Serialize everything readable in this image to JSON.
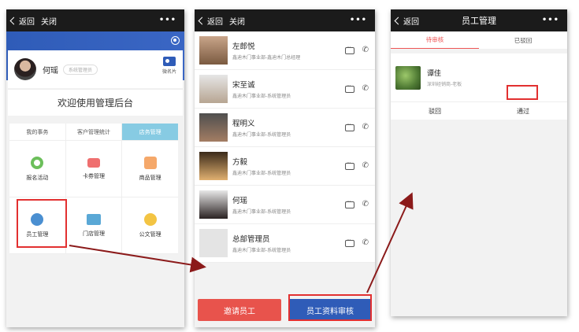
{
  "phone1": {
    "nav": {
      "back": "返回",
      "close": "关闭",
      "more": "•••"
    },
    "user": {
      "name": "何瑶",
      "role": "系统管理员"
    },
    "business_card": "微名片",
    "welcome": "欢迎使用管理后台",
    "tabs": [
      "我的事务",
      "客户管理统计",
      "店务管理"
    ],
    "menu": [
      "报名活动",
      "卡券管理",
      "商品管理",
      "员工管理",
      "门店管理",
      "公文管理"
    ]
  },
  "phone2": {
    "nav": {
      "back": "返回",
      "close": "关闭",
      "more": "•••"
    },
    "contacts": [
      {
        "name": "左郎悦",
        "sub": "鑫迪木门事业部-鑫迪木门总经理"
      },
      {
        "name": "宋至诚",
        "sub": "鑫迪木门事业部-系统管理员"
      },
      {
        "name": "程明义",
        "sub": "鑫迪木门事业部-系统管理员"
      },
      {
        "name": "方毅",
        "sub": "鑫迪木门事业部-系统管理员"
      },
      {
        "name": "何瑶",
        "sub": "鑫迪木门事业部-系统管理员"
      },
      {
        "name": "总部管理员",
        "sub": "鑫迪木门事业部-系统管理员"
      }
    ],
    "invite_label": "邀请员工",
    "review_label": "员工资料审核"
  },
  "phone3": {
    "nav": {
      "back": "返回",
      "title": "员工管理",
      "more": "•••"
    },
    "tabs": [
      "待审核",
      "已驳回"
    ],
    "request": {
      "name": "谭佳",
      "sub": "深圳经销商-老板"
    },
    "reject_label": "驳回",
    "approve_label": "通过"
  },
  "colors": {
    "accent_blue": "#2f5cb8",
    "highlight_red": "#e23030",
    "arrow": "#8b1a1a"
  }
}
